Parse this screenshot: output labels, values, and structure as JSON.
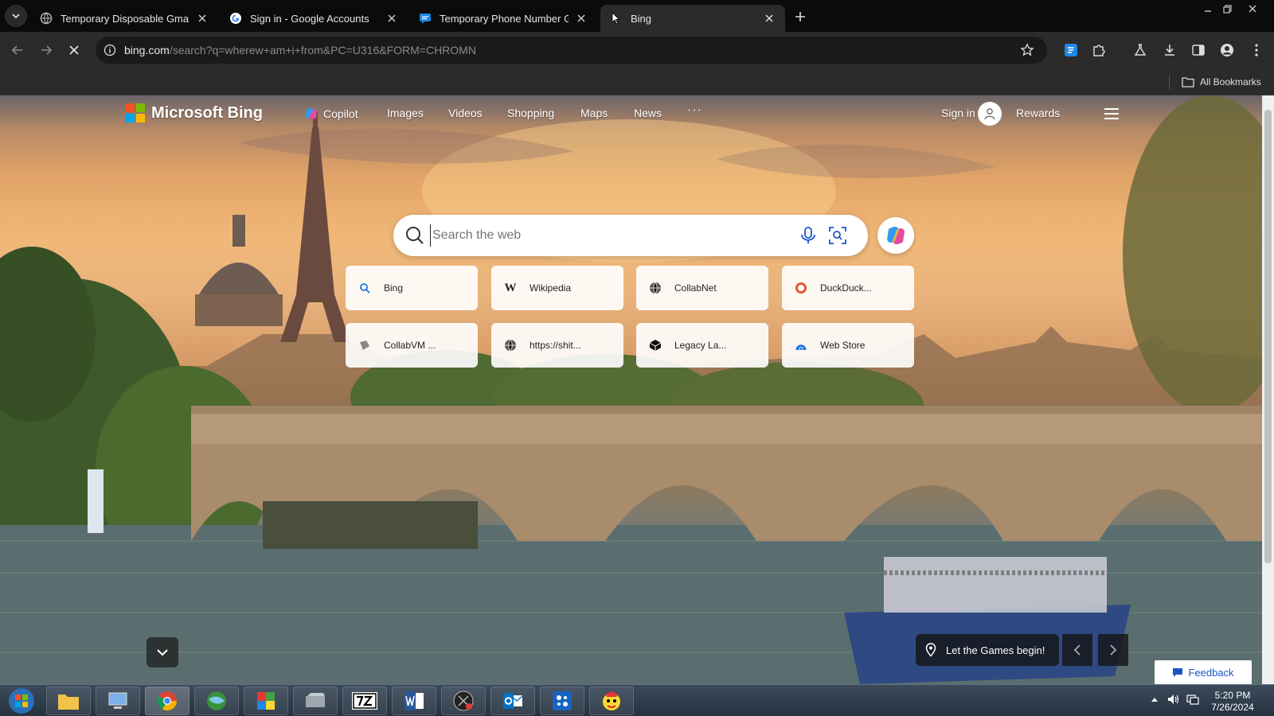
{
  "browser": {
    "tabs": [
      {
        "title": "Temporary Disposable Gmail | T",
        "active": false
      },
      {
        "title": "Sign in - Google Accounts",
        "active": false
      },
      {
        "title": "Temporary Phone Number Gen",
        "active": false
      },
      {
        "title": "Bing",
        "active": true
      }
    ],
    "url_host": "bing.com",
    "url_path": "/search?q=wherew+am+i+from&PC=U316&FORM=CHROMN",
    "bookmarks_label": "All Bookmarks"
  },
  "bing": {
    "logo_text": "Microsoft Bing",
    "nav": [
      "Copilot",
      "Images",
      "Videos",
      "Shopping",
      "Maps",
      "News",
      "···"
    ],
    "signin": "Sign in",
    "rewards": "Rewards",
    "search_placeholder": "Search the web",
    "quick_links": [
      {
        "label": "Bing",
        "icon": "bing-search-icon"
      },
      {
        "label": "Wikipedia",
        "icon": "wikipedia-icon"
      },
      {
        "label": "CollabNet",
        "icon": "globe-icon"
      },
      {
        "label": "DuckDuck...",
        "icon": "duckduckgo-icon"
      },
      {
        "label": "CollabVM ...",
        "icon": "collabvm-icon"
      },
      {
        "label": "https://shit...",
        "icon": "globe-icon"
      },
      {
        "label": "Legacy La...",
        "icon": "cube-icon"
      },
      {
        "label": "Web Store",
        "icon": "webstore-icon"
      }
    ],
    "image_caption": "Let the Games begin!",
    "feedback": "Feedback"
  },
  "taskbar": {
    "apps": [
      "explorer",
      "computer",
      "chrome",
      "globe-browser",
      "colorful-app",
      "archive-tool",
      "7zip",
      "word",
      "media-player",
      "outlook",
      "blue-app",
      "character-app"
    ],
    "time": "5:20 PM",
    "date": "7/26/2024"
  },
  "colors": {
    "tabstrip": "#0b0b0b",
    "toolbar": "#2b2b2b",
    "taskbar": "#253240",
    "feedback_text": "#1a56c6"
  }
}
